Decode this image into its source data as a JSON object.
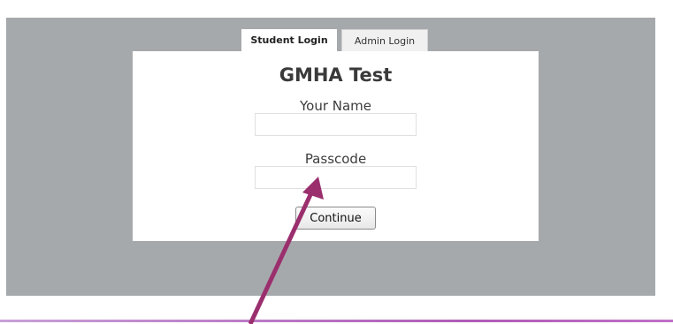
{
  "tabs": [
    {
      "label": "Student Login",
      "active": true
    },
    {
      "label": "Admin Login",
      "active": false
    }
  ],
  "form": {
    "title": "GMHA Test",
    "name_label": "Your Name",
    "name_value": "",
    "passcode_label": "Passcode",
    "passcode_value": "",
    "continue_label": "Continue"
  },
  "colors": {
    "panel_background": "#a6a9ac",
    "annotation_arrow": "#9b2f6e",
    "bottom_rule": "#b05bb8"
  },
  "annotation": {
    "type": "arrow",
    "points_to": "passcode-input"
  }
}
